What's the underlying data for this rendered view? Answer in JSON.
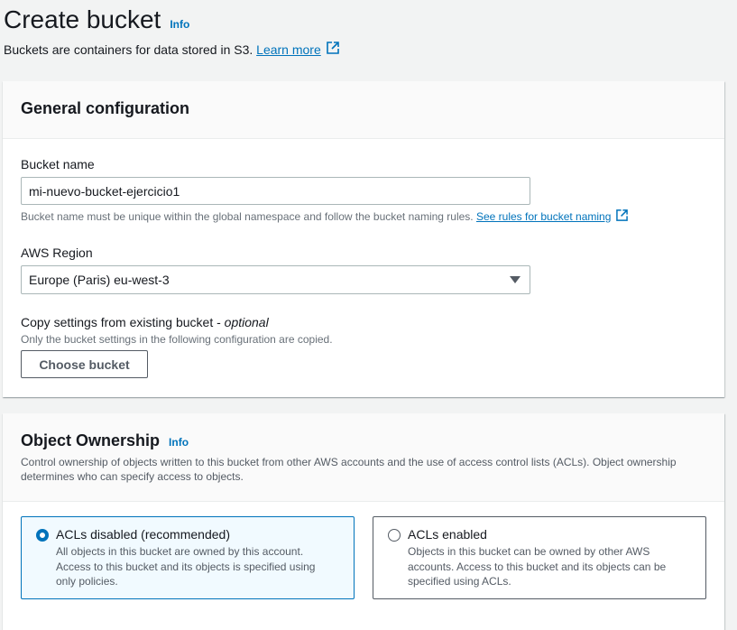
{
  "header": {
    "title": "Create bucket",
    "info": "Info",
    "description": "Buckets are containers for data stored in S3.",
    "learn_more": "Learn more"
  },
  "general": {
    "title": "General configuration",
    "bucket_name_label": "Bucket name",
    "bucket_name_value": "mi-nuevo-bucket-ejercicio1",
    "bucket_name_hint": "Bucket name must be unique within the global namespace and follow the bucket naming rules.",
    "naming_rules_link": "See rules for bucket naming",
    "region_label": "AWS Region",
    "region_value": "Europe (Paris) eu-west-3",
    "copy_label": "Copy settings from existing bucket -",
    "copy_optional": "optional",
    "copy_hint": "Only the bucket settings in the following configuration are copied.",
    "choose_button": "Choose bucket"
  },
  "ownership": {
    "title": "Object Ownership",
    "info": "Info",
    "description": "Control ownership of objects written to this bucket from other AWS accounts and the use of access control lists (ACLs). Object ownership determines who can specify access to objects.",
    "options": [
      {
        "label": "ACLs disabled (recommended)",
        "description": "All objects in this bucket are owned by this account. Access to this bucket and its objects is specified using only policies.",
        "selected": true
      },
      {
        "label": "ACLs enabled",
        "description": "Objects in this bucket can be owned by other AWS accounts. Access to this bucket and its objects can be specified using ACLs.",
        "selected": false
      }
    ]
  },
  "colors": {
    "accent": "#0073bb",
    "border": "#aab7b8",
    "page_bg": "#f2f3f3"
  },
  "icons": {
    "external": "external-link-icon",
    "caret": "caret-down-icon",
    "radio": "radio-icon"
  }
}
